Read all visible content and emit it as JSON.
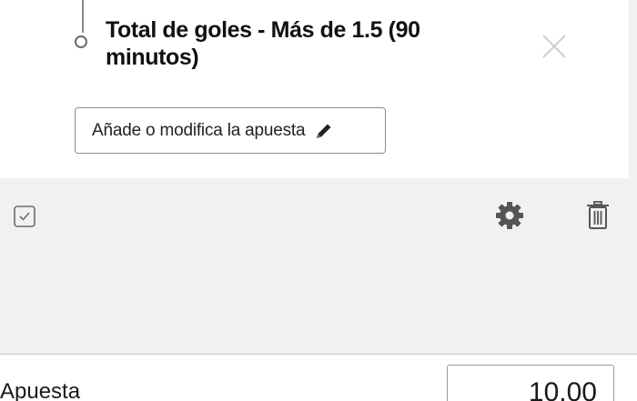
{
  "selection": {
    "market_title": "Total de goles - Más de 1.5 (90 minutos)",
    "modify_button_label": "Añade o modifica la apuesta",
    "close_icon": "close-icon",
    "pencil_icon": "pencil-icon"
  },
  "tools": {
    "checkbox_icon": "checkbox-checked-icon",
    "settings_icon": "gear-icon",
    "delete_icon": "trash-icon"
  },
  "stake": {
    "label": "Apuesta",
    "value": "10.00"
  },
  "colors": {
    "panel_background": "#f1f1f1",
    "card_background": "#ffffff",
    "text_primary": "#111111",
    "icon_gray": "#555555",
    "border_gray": "#8c8c8c"
  }
}
